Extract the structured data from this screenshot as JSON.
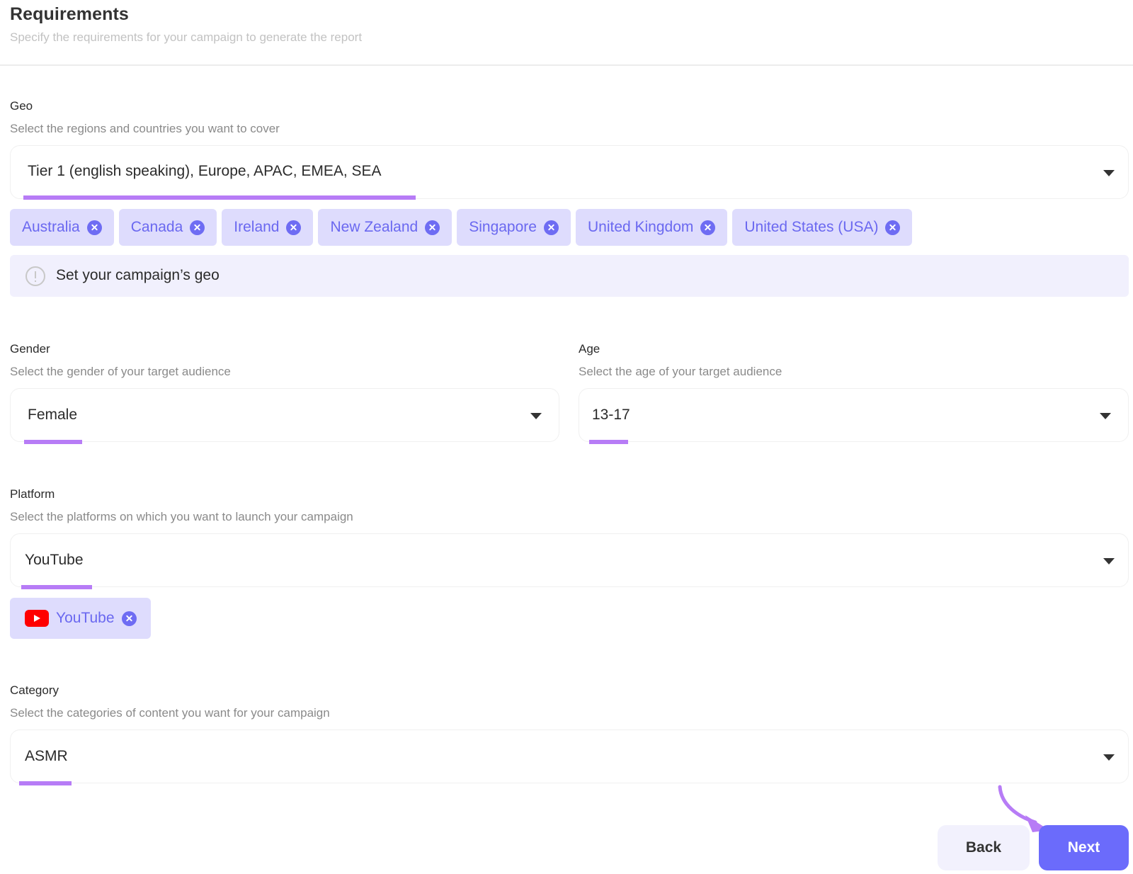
{
  "header": {
    "title": "Requirements",
    "subtitle": "Specify the requirements for your campaign to generate the report"
  },
  "geo": {
    "label": "Geo",
    "help": "Select the regions and countries you want to cover",
    "value": "Tier 1 (english speaking), Europe, APAC, EMEA, SEA",
    "chips": [
      "Australia",
      "Canada",
      "Ireland",
      "New Zealand",
      "Singapore",
      "United Kingdom",
      "United States (USA)"
    ],
    "alert": "Set your campaign’s geo"
  },
  "gender": {
    "label": "Gender",
    "help": "Select the gender of your target audience",
    "value": "Female"
  },
  "age": {
    "label": "Age",
    "help": "Select the age of your target audience",
    "value": "13-17"
  },
  "platform": {
    "label": "Platform",
    "help": "Select the platforms on which you want to launch your campaign",
    "value": "YouTube",
    "chips": [
      {
        "label": "YouTube",
        "icon": "youtube-icon"
      }
    ]
  },
  "category": {
    "label": "Category",
    "help": "Select the categories of content you want for your campaign",
    "value": "ASMR"
  },
  "actions": {
    "back_label": "Back",
    "next_label": "Next"
  },
  "colors": {
    "accent": "#6b6bfb",
    "chip_bg": "#dedcfd",
    "chip_text": "#6a68f0",
    "underline": "#b77cf6",
    "alert_bg": "#f1f0fd",
    "youtube_red": "#ff0000"
  }
}
